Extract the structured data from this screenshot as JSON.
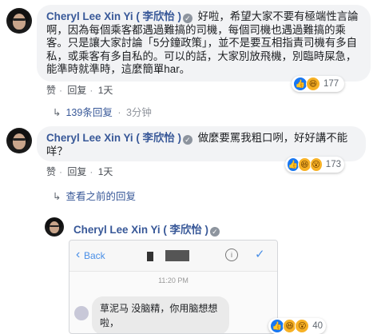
{
  "comments": [
    {
      "author": "Cheryl Lee Xin Yi ( 李欣怡 )",
      "text": "好啦，希望大家不要有極端性言論啊，因為每個乘客都遇過難搞的司機，每個司機也遇過難搞的乘客。只是讓大家討論「5分鐘政策」，並不是要互相指責司機有多自私，或乘客有多自私的。可以的話，大家別放飛機，別臨時屎急，能準時就準時，這麼簡單har。",
      "like_label": "赞",
      "reply_label": "回复",
      "time": "1天",
      "reaction_count": "177"
    },
    {
      "author": "Cheryl Lee Xin Yi ( 李欣怡 )",
      "text": "做麼要罵我粗口咧，好好講不能咩？",
      "like_label": "赞",
      "reply_label": "回复",
      "time": "1天",
      "reaction_count": "173"
    }
  ],
  "replies_summary": {
    "count_label": "139条回复",
    "time": "3分钟"
  },
  "view_previous": "查看之前的回复",
  "reply": {
    "author": "Cheryl Lee Xin Yi ( 李欣怡 )",
    "reaction_count": "40"
  },
  "screenshot": {
    "back_label": "Back",
    "time": "11:20 PM",
    "message": "草泥马 没脑精，你用脑想想啦，"
  },
  "colors": {
    "link": "#385898",
    "bubble": "#f2f3f5",
    "like": "#1877f2"
  }
}
